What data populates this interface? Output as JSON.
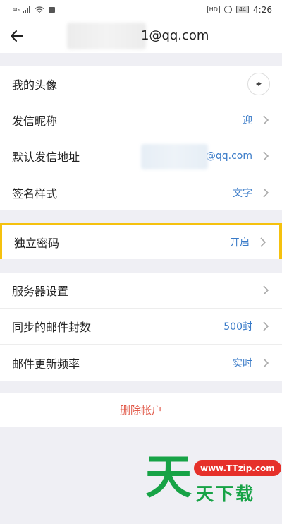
{
  "status_bar": {
    "network_label": "4G",
    "hd_label": "HD",
    "battery": "44",
    "time": "4:26"
  },
  "header": {
    "title": "1@qq.com",
    "back_icon": "arrow-left-icon"
  },
  "settings": {
    "avatar_label": "我的头像",
    "nickname_label": "发信昵称",
    "nickname_value": "迎",
    "default_address_label": "默认发信地址",
    "default_address_value": "@qq.com",
    "signature_label": "签名样式",
    "signature_value": "文字",
    "independent_password_label": "独立密码",
    "independent_password_value": "开启",
    "server_settings_label": "服务器设置",
    "sync_count_label": "同步的邮件封数",
    "sync_count_value": "500封",
    "update_frequency_label": "邮件更新频率",
    "update_frequency_value": "实时"
  },
  "delete_account_label": "删除帐户",
  "watermark": {
    "big_char": "天",
    "url": "www.TTzip.com",
    "brand_text": "天下载"
  },
  "colors": {
    "accent_blue": "#3a7bc8",
    "delete_red": "#e15a4a",
    "highlight_yellow": "#f5c10e",
    "watermark_green": "#17a346",
    "watermark_red": "#e6302a"
  }
}
